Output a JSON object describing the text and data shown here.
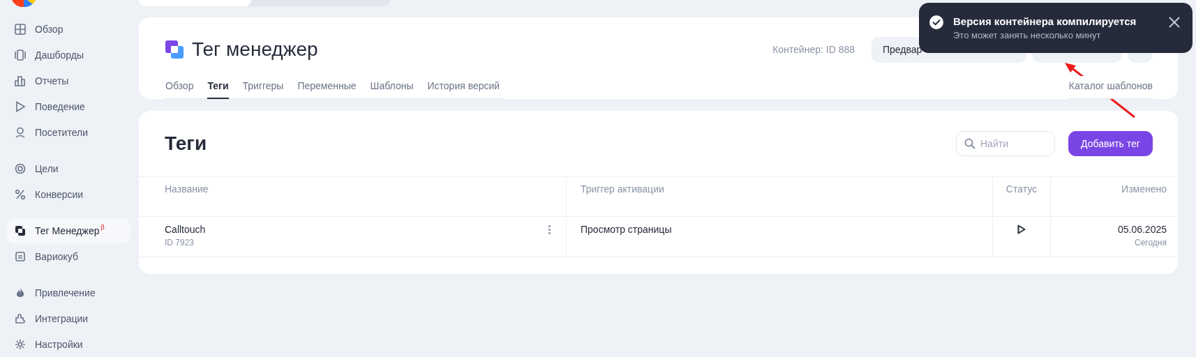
{
  "sidebar": {
    "groups": [
      {
        "items": [
          {
            "label": "Обзор",
            "selected": false
          },
          {
            "label": "Дашборды",
            "selected": false
          },
          {
            "label": "Отчеты",
            "selected": false
          },
          {
            "label": "Поведение",
            "selected": false
          },
          {
            "label": "Посетители",
            "selected": false
          }
        ]
      },
      {
        "items": [
          {
            "label": "Цели",
            "selected": false
          },
          {
            "label": "Конверсии",
            "selected": false
          }
        ]
      },
      {
        "items": [
          {
            "label": "Тег Менеджер",
            "badge": "β",
            "selected": true
          },
          {
            "label": "Вариокуб",
            "selected": false
          }
        ]
      },
      {
        "items": [
          {
            "label": "Привлечение",
            "selected": false
          },
          {
            "label": "Интеграции",
            "selected": false
          },
          {
            "label": "Настройки",
            "selected": false
          }
        ]
      }
    ]
  },
  "header": {
    "title": "Тег менеджер",
    "container": "Контейнер: ID 888",
    "buttons": [
      {
        "kind": "text",
        "label": "Предвар"
      },
      {
        "kind": "blank"
      },
      {
        "kind": "round"
      }
    ],
    "tabs": [
      {
        "label": "Обзор",
        "selected": false
      },
      {
        "label": "Теги",
        "selected": true
      },
      {
        "label": "Триггеры",
        "selected": false
      },
      {
        "label": "Переменные",
        "selected": false
      },
      {
        "label": "Шаблоны",
        "selected": false
      },
      {
        "label": "История версий",
        "selected": false
      }
    ],
    "catalog_link": "Каталог шаблонов"
  },
  "toast": {
    "title": "Версия контейнера компилируется",
    "message": "Это может занять несколько минут"
  },
  "tags": {
    "title": "Теги",
    "search": {
      "placeholder": "Найти"
    },
    "add_button": "Добавить тег",
    "columns": [
      {
        "label": "Название"
      },
      {
        "label": "Триггер активации"
      },
      {
        "label": "Статус"
      },
      {
        "label": "Изменено"
      }
    ],
    "rows": [
      {
        "name": "Calltouch",
        "id": "ID 7923",
        "trigger": "Просмотр страницы",
        "status": {
          "kind": "play"
        },
        "date": "05.06.2025",
        "relative": "Сегодня"
      }
    ]
  }
}
